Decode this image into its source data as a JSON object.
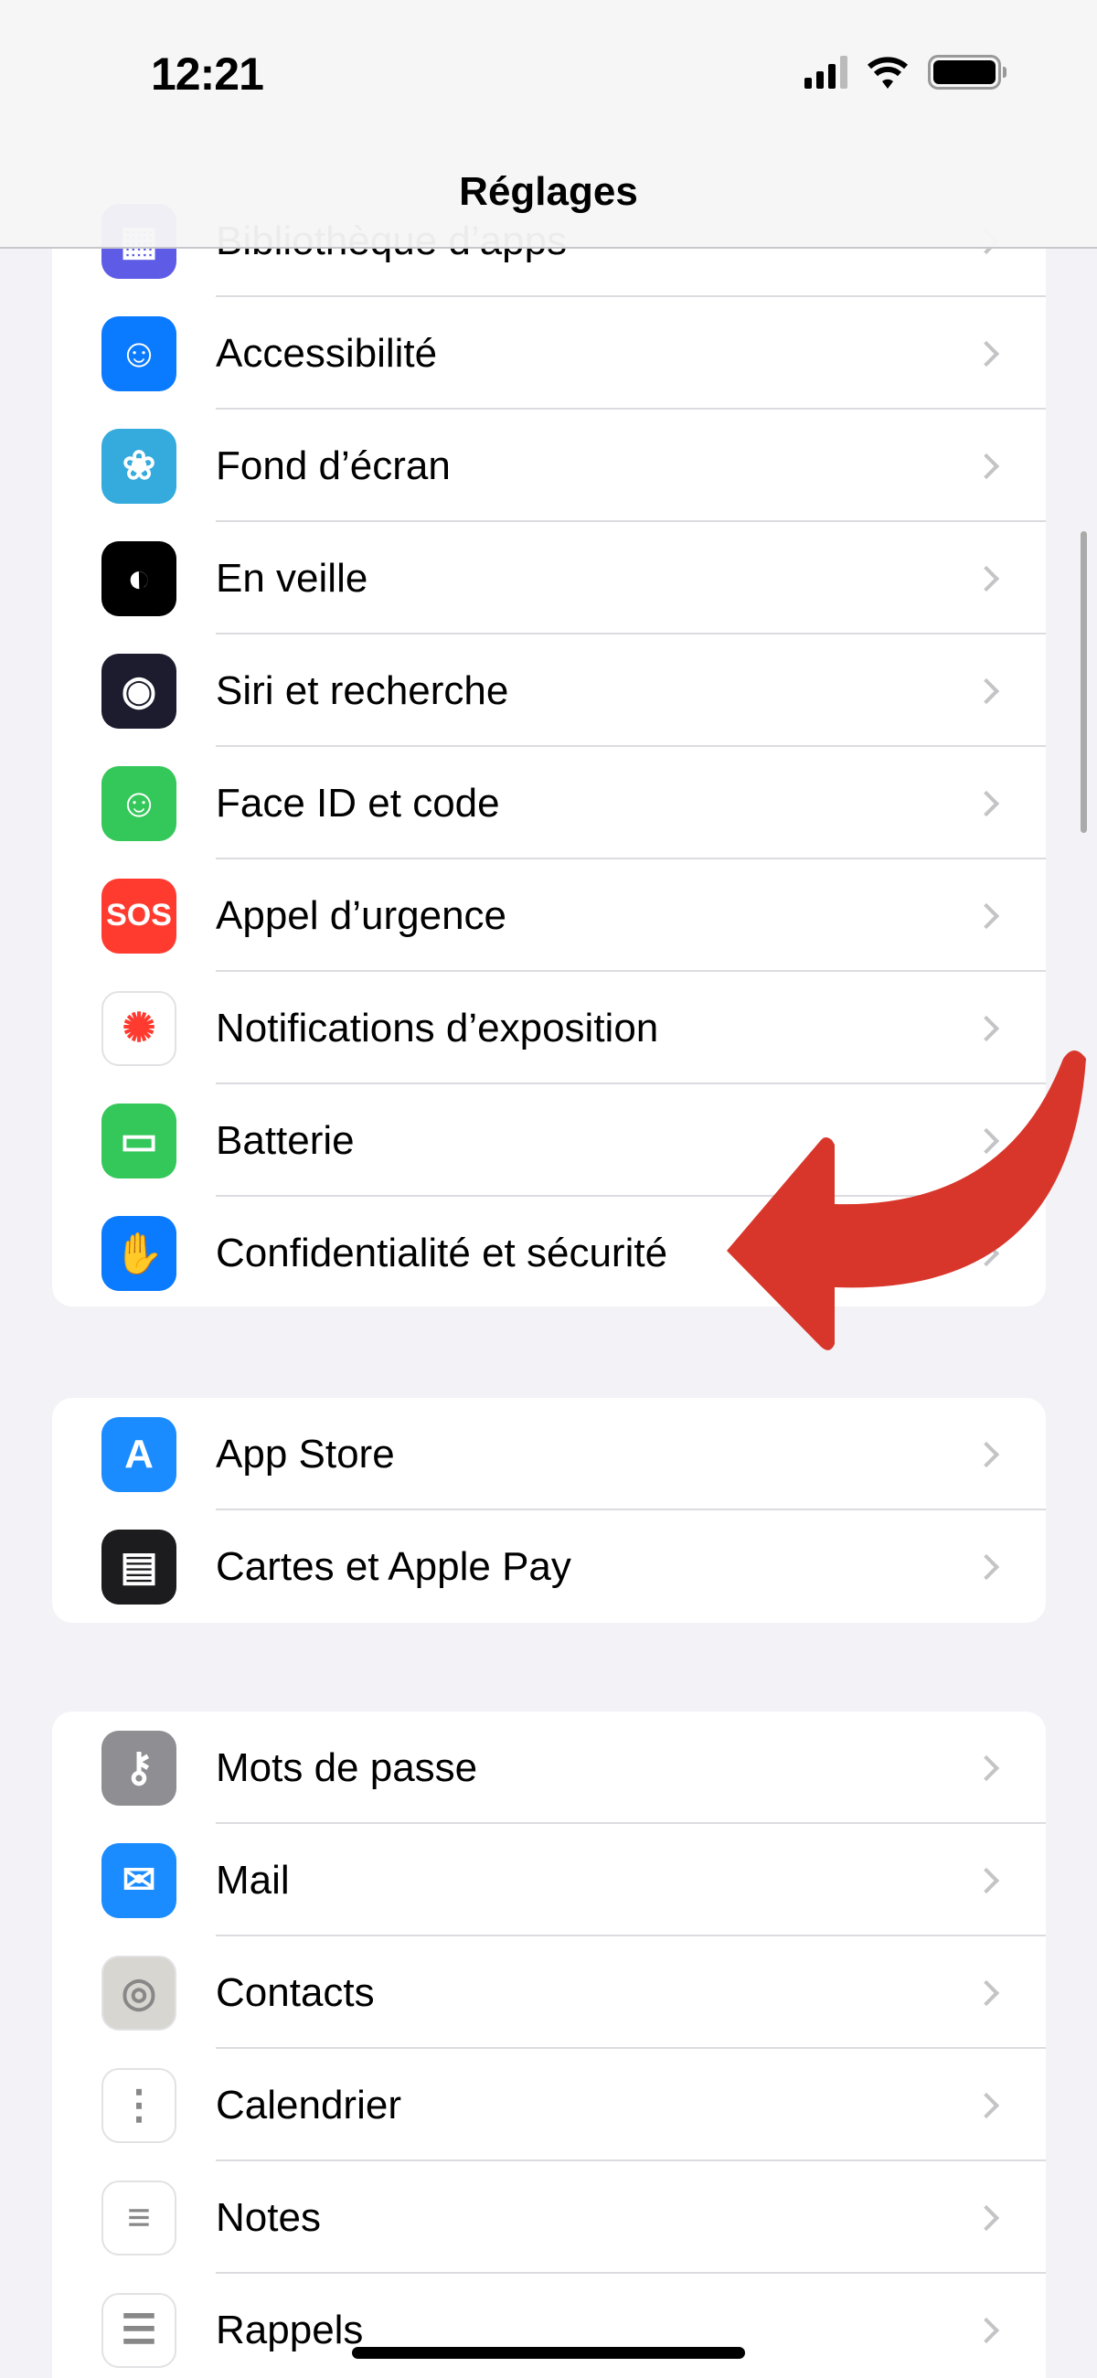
{
  "status_bar": {
    "time": "12:21",
    "icons": [
      "cellular-signal-icon",
      "wifi-icon",
      "battery-icon"
    ]
  },
  "header": {
    "title": "Réglages"
  },
  "groups": [
    {
      "items": [
        {
          "label": "Bibliothèque d’apps",
          "icon": "app-library-icon",
          "color": "#5e5ce6"
        },
        {
          "label": "Accessibilité",
          "icon": "accessibility-icon",
          "color": "#0a7aff"
        },
        {
          "label": "Fond d’écran",
          "icon": "wallpaper-flower-icon",
          "color": "#35aadc"
        },
        {
          "label": "En veille",
          "icon": "standby-icon",
          "color": "#000000"
        },
        {
          "label": "Siri et recherche",
          "icon": "siri-icon",
          "color": "#1c1c2e"
        },
        {
          "label": "Face ID et code",
          "icon": "face-id-icon",
          "color": "#34c759"
        },
        {
          "label": "Appel d’urgence",
          "icon": "sos-icon",
          "color": "#ff3b30",
          "glyph": "SOS"
        },
        {
          "label": "Notifications d’exposition",
          "icon": "exposure-notifications-icon",
          "color": "#ffffff"
        },
        {
          "label": "Batterie",
          "icon": "battery-icon",
          "color": "#34c759"
        },
        {
          "label": "Confidentialité et sécurité",
          "icon": "privacy-hand-icon",
          "color": "#0a7aff"
        }
      ]
    },
    {
      "items": [
        {
          "label": "App Store",
          "icon": "app-store-icon",
          "color": "#1a8cff"
        },
        {
          "label": "Cartes et Apple Pay",
          "icon": "wallet-icon",
          "color": "#1c1c1e"
        }
      ]
    },
    {
      "items": [
        {
          "label": "Mots de passe",
          "icon": "key-icon",
          "color": "#8e8e93"
        },
        {
          "label": "Mail",
          "icon": "mail-icon",
          "color": "#1a8cff"
        },
        {
          "label": "Contacts",
          "icon": "contacts-icon",
          "color": "#d8d6d0"
        },
        {
          "label": "Calendrier",
          "icon": "calendar-icon",
          "color": "#ffffff"
        },
        {
          "label": "Notes",
          "icon": "notes-icon",
          "color": "#ffffff"
        },
        {
          "label": "Rappels",
          "icon": "reminders-icon",
          "color": "#ffffff"
        }
      ]
    }
  ],
  "annotation": {
    "color": "#d9362b",
    "points_to": "Confidentialité et sécurité"
  }
}
